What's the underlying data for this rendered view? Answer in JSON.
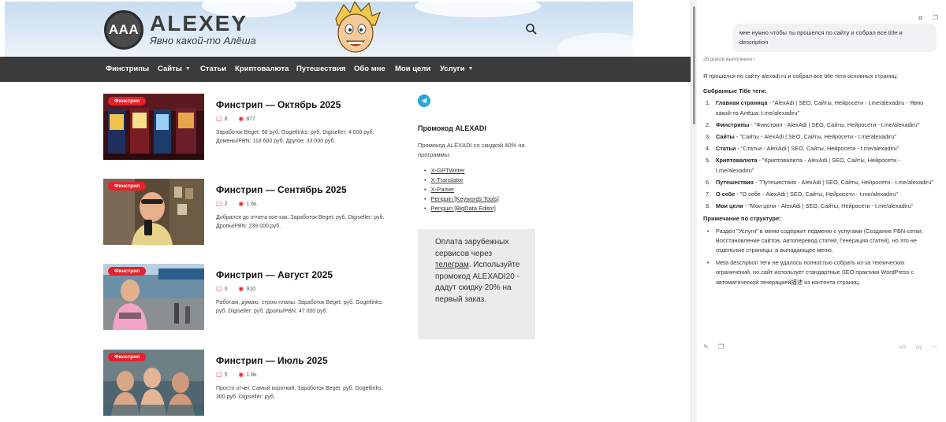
{
  "site": {
    "logo_text": "AAA",
    "name": "ALEXEY",
    "tagline": "Явно какой-то Алёша"
  },
  "icons": {
    "search": "search-icon",
    "telegram": "telegram-icon",
    "comment": "comment-icon",
    "views": "eye-icon"
  },
  "colors": {
    "accent": "#e8202a",
    "nav_bg": "#3b3b3b",
    "telegram": "#2aa3df"
  },
  "nav": {
    "items": [
      {
        "label": "Финстрипы",
        "dropdown": false
      },
      {
        "label": "Сайты",
        "dropdown": true
      },
      {
        "label": "Статьи",
        "dropdown": false
      },
      {
        "label": "Криптовалюта",
        "dropdown": false
      },
      {
        "label": "Путешествия",
        "dropdown": false
      },
      {
        "label": "Обо мне",
        "dropdown": false
      },
      {
        "label": "Мои цели",
        "dropdown": false
      },
      {
        "label": "Услуги",
        "dropdown": true
      }
    ]
  },
  "posts": [
    {
      "badge": "Финстрип",
      "title": "Финстрип — Октябрь 2025",
      "comments": "8",
      "views": "877",
      "excerpt": "Заработок Beget: 58 руб. Gogetlinks: руб. Digiseller: 4 000 руб. Домены/PBN: 118 600 руб. Другое: 33 000 руб."
    },
    {
      "badge": "Финстрип",
      "title": "Финстрип — Сентябрь 2025",
      "comments": "2",
      "views": "1.6к.",
      "excerpt": "Добрался до отчета кое-как. Заработок Beget:  руб. Digiseller:  руб. Дропы/PBN: 239 000 руб."
    },
    {
      "badge": "Финстрип",
      "title": "Финстрип — Август 2025",
      "comments": "0",
      "views": "910",
      "excerpt": "Работаю, думаю, строю планы. Заработок Beget: руб. Gogetlinks: руб. Digiseller: руб. Дропы/PBN: 47 000 руб."
    },
    {
      "badge": "Финстрип",
      "title": "Финстрип — Июль 2025",
      "comments": "5",
      "views": "1.8к.",
      "excerpt": "Просто отчет. Самый короткий. Заработок Beget:  руб. Gogetlinks: 300 руб. Digiseller:  руб."
    }
  ],
  "widget": {
    "promo_title": "Промокод ALEXADI",
    "promo_text": "Промокод ALEXADI со скидкой 40% на программы:",
    "links": [
      "X-GPTWriter",
      "X-Translator",
      "X-Parser",
      "Penguin [Keywords Tools]",
      "Penguin [BigData Editor]"
    ],
    "ad_part1": "Оплата зарубежных сервисов через ",
    "ad_link": "телеграм",
    "ad_part2": ". Используйте промокод ALEXADI20 - дадут скидку 20% на первый заказ."
  },
  "chat": {
    "user_message": "мне нужно чтобы ты прошелся по сайту и собрал все title и description",
    "steps": "25 шагов выполнено",
    "intro": "Я прошелся по сайту alexadi.ru и собрал все title теги основных страниц:",
    "titles_heading": "Собранные Title теги:",
    "titles": [
      {
        "n": "1.",
        "name": "Главная страница",
        "value": " - \"AlexAdi | SEO, Сайты, Нейросети - t.me/alexadiru - Явно какой-то Алёша: t.me/alexadiru\""
      },
      {
        "n": "2.",
        "name": "Финстрипы",
        "value": " - \"Финстрип - AlexAdi | SEO, Сайты, Нейросети - t.me/alexadiru\""
      },
      {
        "n": "3.",
        "name": "Сайты",
        "value": " - \"Сайты - AlexAdi | SEO, Сайты, Нейросети - t.me/alexadiru\""
      },
      {
        "n": "4.",
        "name": "Статьи",
        "value": " - \"Статьи - AlexAdi | SEO, Сайты, Нейросети - t.me/alexadiru\""
      },
      {
        "n": "5.",
        "name": "Криптовалюта",
        "value": " - \"Криптовалюта - AlexAdi | SEO, Сайты, Нейросети - t.me/alexadiru\""
      },
      {
        "n": "6.",
        "name": "Путешествия",
        "value": " - \"Путешествия - AlexAdi | SEO, Сайты, Нейросети - t.me/alexadiru\""
      },
      {
        "n": "7.",
        "name": "О себе",
        "value": " - \"О себе - AlexAdi | SEO, Сайты, Нейросети - t.me/alexadiru\""
      },
      {
        "n": "8.",
        "name": "Мои цели",
        "value": " - \"Мои цели - AlexAdi | SEO, Сайты, Нейросети - t.me/alexadiru\""
      }
    ],
    "note_heading": "Примечание по структуре:",
    "notes": [
      "Раздел \"Услуги\" в меню содержит подменю с услугами (Создание PBN-сетки, Восстановление сайтов, Автоперевод статей, Генерация статей), но это не отдельные страницы, а выпадающее меню.",
      "Meta description теги не удалось полностью собрать из-за технических ограничений, но сайт использует стандартные SEO практики WordPress с автоматической генерацией描述 из контента страниц."
    ]
  }
}
